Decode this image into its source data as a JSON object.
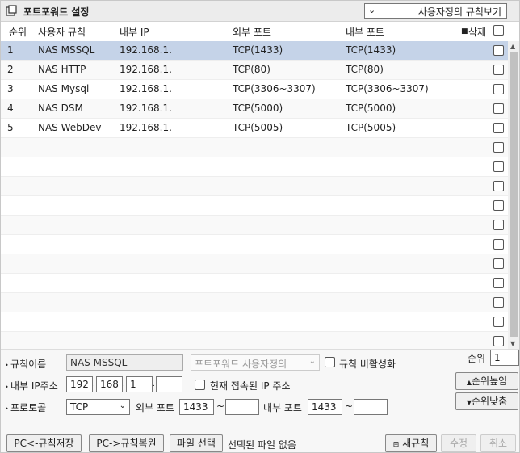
{
  "title": "포트포워드 설정",
  "view_select": {
    "value": "사용자정의 규칙보기"
  },
  "table": {
    "headers": {
      "rank": "순위",
      "rule": "사용자 규칙",
      "ip": "내부 IP",
      "ext": "외부 포트",
      "int": "내부 포트",
      "delete": "삭제"
    },
    "rows": [
      {
        "rank": "1",
        "rule": "NAS MSSQL",
        "ip": "192.168.1.",
        "ext": "TCP(1433)",
        "int": "TCP(1433)"
      },
      {
        "rank": "2",
        "rule": "NAS HTTP",
        "ip": "192.168.1.",
        "ext": "TCP(80)",
        "int": "TCP(80)"
      },
      {
        "rank": "3",
        "rule": "NAS Mysql",
        "ip": "192.168.1.",
        "ext": "TCP(3306~3307)",
        "int": "TCP(3306~3307)"
      },
      {
        "rank": "4",
        "rule": "NAS DSM",
        "ip": "192.168.1.",
        "ext": "TCP(5000)",
        "int": "TCP(5000)"
      },
      {
        "rank": "5",
        "rule": "NAS WebDev",
        "ip": "192.168.1.",
        "ext": "TCP(5005)",
        "int": "TCP(5005)"
      }
    ],
    "empty_rows": 11
  },
  "form": {
    "rule_name_label": "규칙이름",
    "rule_name_value": "NAS MSSQL",
    "custom_select": "포트포워드 사용자정의",
    "disable_rule_label": "규칙 비활성화",
    "ip_label": "내부 IP주소",
    "ip": [
      "192",
      "168",
      "1",
      ""
    ],
    "current_ip_label": "현재 접속된 IP 주소",
    "protocol_label": "프로토콜",
    "protocol_value": "TCP",
    "ext_port_label": "외부 포트",
    "ext_port_from": "1433",
    "ext_port_to": "",
    "int_port_label": "내부 포트",
    "int_port_from": "1433",
    "int_port_to": "",
    "tilde": "~",
    "rank_label": "순위",
    "rank_value": "1",
    "rank_up": "순위높임",
    "rank_down": "순위낮춤"
  },
  "bottom": {
    "save_to_pc": "PC<-규칙저장",
    "restore_from_pc": "PC->규칙복원",
    "file_select": "파일 선택",
    "file_status": "선택된 파일 없음",
    "new_rule": "새규칙",
    "modify": "수정",
    "cancel": "취소"
  }
}
